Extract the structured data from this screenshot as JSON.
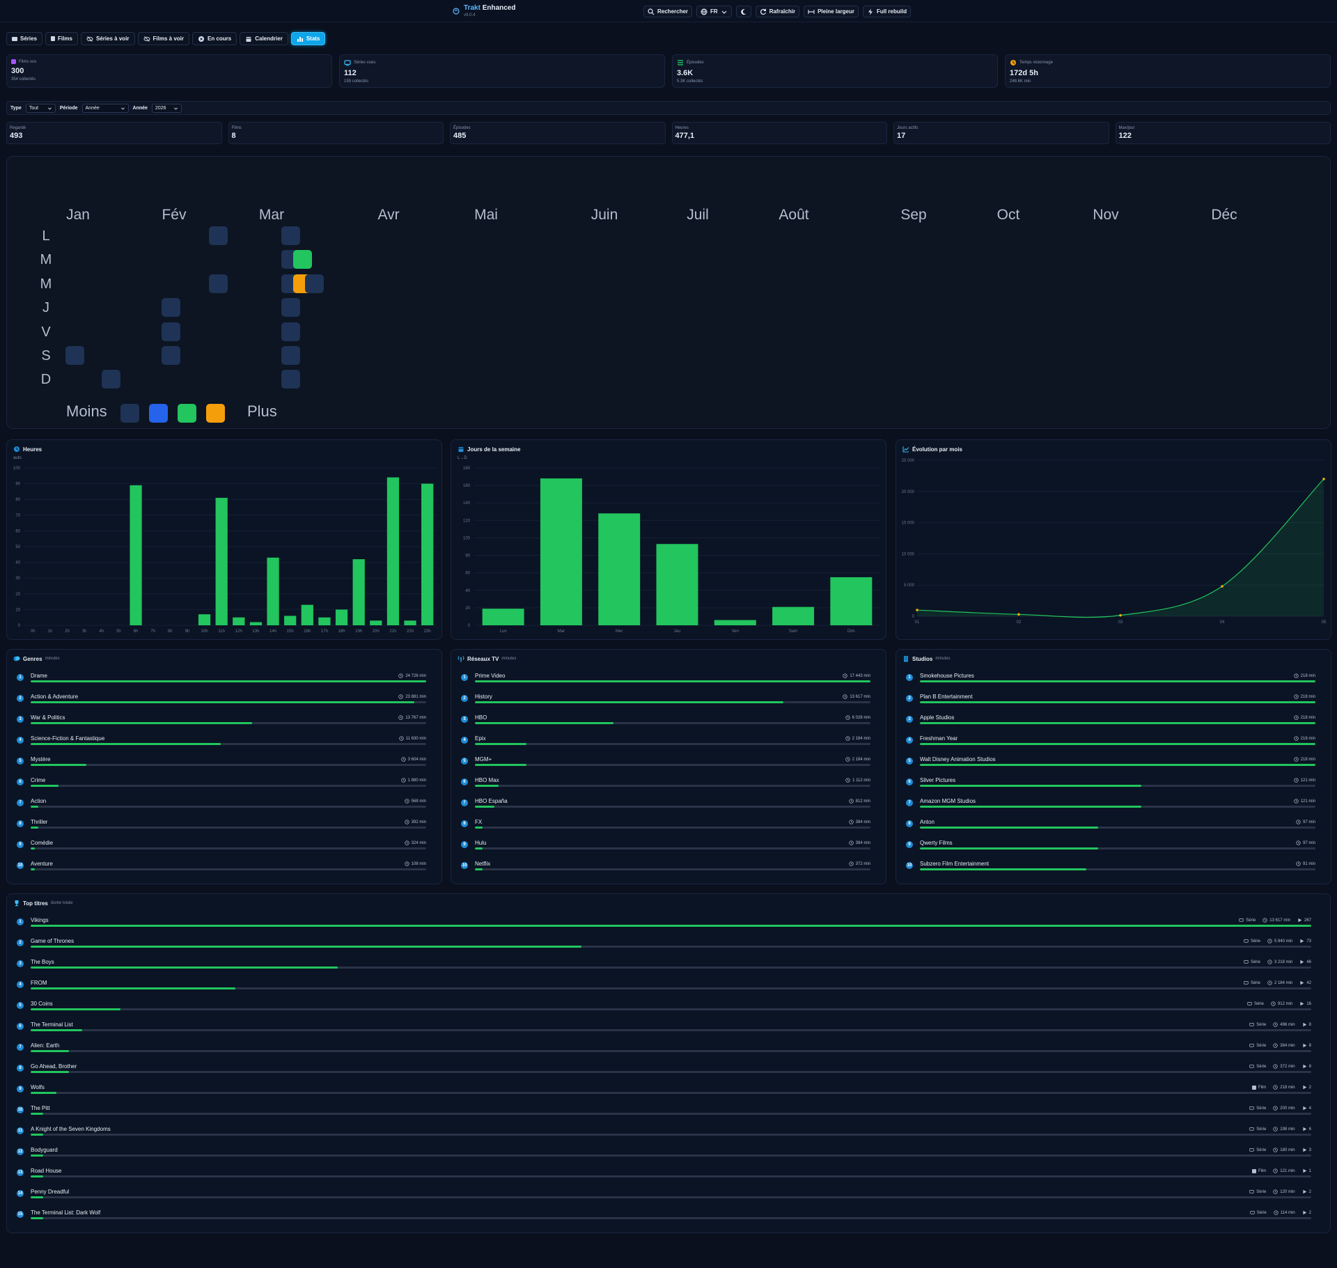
{
  "header": {
    "brand_part1": "Trakt",
    "brand_part2": "Enhanced",
    "version": "v9.0.4",
    "buttons": [
      {
        "label": "Rechercher",
        "icon": "search-icon"
      },
      {
        "label": "FR",
        "icon": "globe-icon"
      },
      {
        "label": "",
        "icon": "moon-icon"
      },
      {
        "label": "Rafraîchir",
        "icon": "refresh-icon"
      },
      {
        "label": "Pleine largeur",
        "icon": "arrows-horizontal-icon"
      },
      {
        "label": "Full rebuild",
        "icon": "bolt-icon"
      }
    ]
  },
  "tabs": [
    {
      "label": "Séries",
      "icon": "tv-icon",
      "active": false
    },
    {
      "label": "Films",
      "icon": "film-icon",
      "active": false
    },
    {
      "label": "Séries à voir",
      "icon": "eye-off-icon",
      "active": false
    },
    {
      "label": "Films à voir",
      "icon": "eye-off-icon",
      "active": false
    },
    {
      "label": "En cours",
      "icon": "play-circle-icon",
      "active": false
    },
    {
      "label": "Calendrier",
      "icon": "calendar-icon",
      "active": false
    },
    {
      "label": "Stats",
      "icon": "bar-chart-icon",
      "active": true
    }
  ],
  "kpis": [
    {
      "label": "Films vus",
      "value": "300",
      "sub": "354 collectés",
      "color": "#a855f7",
      "icon": "film-icon"
    },
    {
      "label": "Séries vues",
      "value": "112",
      "sub": "159 collectés",
      "color": "#38bdf8",
      "icon": "tv-icon"
    },
    {
      "label": "Épisodes",
      "value": "3.6K",
      "sub": "5.3K collectés",
      "color": "#22c55e",
      "icon": "list-icon"
    },
    {
      "label": "Temps visionnage",
      "value": "172d 5h",
      "sub": "248.6K min",
      "color": "#f59e0b",
      "icon": "clock-icon"
    }
  ],
  "filters": {
    "type_label": "Type",
    "type_value": "Tout",
    "period_label": "Période",
    "period_value": "Année",
    "year_label": "Année",
    "year_value": "2026"
  },
  "summary": [
    {
      "label": "Regardé",
      "value": "493"
    },
    {
      "label": "Films",
      "value": "8"
    },
    {
      "label": "Épisodes",
      "value": "485"
    },
    {
      "label": "Heures",
      "value": "477,1"
    },
    {
      "label": "Jours actifs",
      "value": "17"
    },
    {
      "label": "Max/jour",
      "value": "122"
    }
  ],
  "heatmap": {
    "months": [
      "Jan",
      "Fév",
      "Mar",
      "Avr",
      "Mai",
      "Juin",
      "Juil",
      "Août",
      "Sep",
      "Oct",
      "Nov",
      "Déc"
    ],
    "days": [
      "L",
      "M",
      "M",
      "J",
      "V",
      "S",
      "D"
    ],
    "legend_less": "Moins",
    "legend_more": "Plus",
    "level_colors": [
      "#1e3355",
      "#2563eb",
      "#22c55e",
      "#f59e0b"
    ],
    "active_cells": [
      {
        "week": 0,
        "day": 5,
        "level": 0
      },
      {
        "week": 3,
        "day": 6,
        "level": 0
      },
      {
        "week": 8,
        "day": 3,
        "level": 0
      },
      {
        "week": 8,
        "day": 4,
        "level": 0
      },
      {
        "week": 8,
        "day": 5,
        "level": 0
      },
      {
        "week": 12,
        "day": 0,
        "level": 0
      },
      {
        "week": 12,
        "day": 2,
        "level": 0
      },
      {
        "week": 18,
        "day": 0,
        "level": 0
      },
      {
        "week": 18,
        "day": 1,
        "level": 0
      },
      {
        "week": 18,
        "day": 2,
        "level": 0
      },
      {
        "week": 18,
        "day": 3,
        "level": 0
      },
      {
        "week": 18,
        "day": 4,
        "level": 0
      },
      {
        "week": 18,
        "day": 5,
        "level": 0
      },
      {
        "week": 18,
        "day": 6,
        "level": 0
      },
      {
        "week": 19,
        "day": 1,
        "level": 2
      },
      {
        "week": 19,
        "day": 2,
        "level": 3
      },
      {
        "week": 20,
        "day": 2,
        "level": 0
      }
    ]
  },
  "hours_panel": {
    "title": "Heures",
    "hint": "auto"
  },
  "weekday_panel": {
    "title": "Jours de la semaine",
    "hint": "L→D"
  },
  "monthly_panel": {
    "title": "Évolution par mois"
  },
  "chart_data": [
    {
      "type": "bar",
      "title": "Heures",
      "categories": [
        "0h",
        "1h",
        "2h",
        "3h",
        "4h",
        "5h",
        "6h",
        "7h",
        "8h",
        "9h",
        "10h",
        "11h",
        "12h",
        "13h",
        "14h",
        "15h",
        "16h",
        "17h",
        "18h",
        "19h",
        "20h",
        "21h",
        "22h",
        "23h"
      ],
      "values": [
        0,
        0,
        0,
        0,
        0,
        0,
        89,
        0,
        0,
        0,
        7,
        81,
        5,
        2,
        43,
        6,
        13,
        5,
        10,
        42,
        3,
        94,
        3,
        90
      ],
      "ylim": [
        0,
        100
      ],
      "yticks": [
        0,
        10,
        20,
        30,
        40,
        50,
        60,
        70,
        80,
        90,
        100
      ],
      "color": "#22c55e"
    },
    {
      "type": "bar",
      "title": "Jours de la semaine",
      "categories": [
        "Lun",
        "Mar",
        "Mer",
        "Jeu",
        "Ven",
        "Sam",
        "Dim"
      ],
      "values": [
        19,
        168,
        128,
        93,
        6,
        21,
        55
      ],
      "ylim": [
        0,
        180
      ],
      "yticks": [
        0,
        20,
        40,
        60,
        80,
        100,
        120,
        140,
        160,
        180
      ],
      "color": "#22c55e"
    },
    {
      "type": "area",
      "title": "Évolution par mois",
      "categories": [
        "01",
        "02",
        "03",
        "04",
        "05"
      ],
      "values": [
        1000,
        300,
        150,
        4800,
        22000
      ],
      "ylim": [
        0,
        25000
      ],
      "yticks": [
        0,
        5000,
        10000,
        15000,
        20000,
        25000
      ],
      "ytick_labels": [
        "0",
        "5 000",
        "10 000",
        "15 000",
        "20 000",
        "25 000"
      ],
      "color": "#22c55e",
      "point_color": "#eab308"
    }
  ],
  "genres": {
    "title": "Genres",
    "subtitle": "minutes",
    "items": [
      {
        "name": "Drame",
        "value": "24 726 min",
        "pct": 100
      },
      {
        "name": "Action & Adventure",
        "value": "23 881 min",
        "pct": 97
      },
      {
        "name": "War & Politics",
        "value": "13 767 min",
        "pct": 56
      },
      {
        "name": "Science-Fiction & Fantastique",
        "value": "11 630 min",
        "pct": 48
      },
      {
        "name": "Mystère",
        "value": "3 604 min",
        "pct": 14
      },
      {
        "name": "Crime",
        "value": "1 880 min",
        "pct": 7
      },
      {
        "name": "Action",
        "value": "568 min",
        "pct": 2
      },
      {
        "name": "Thriller",
        "value": "392 min",
        "pct": 2
      },
      {
        "name": "Comédie",
        "value": "324 min",
        "pct": 1
      },
      {
        "name": "Aventure",
        "value": "108 min",
        "pct": 1
      }
    ]
  },
  "networks": {
    "title": "Réseaux TV",
    "subtitle": "minutes",
    "items": [
      {
        "name": "Prime Video",
        "value": "17 443 min",
        "pct": 100
      },
      {
        "name": "History",
        "value": "13 617 min",
        "pct": 78
      },
      {
        "name": "HBO",
        "value": "6 028 min",
        "pct": 35
      },
      {
        "name": "Epix",
        "value": "2 184 min",
        "pct": 13
      },
      {
        "name": "MGM+",
        "value": "2 184 min",
        "pct": 13
      },
      {
        "name": "HBO Max",
        "value": "1 112 min",
        "pct": 6
      },
      {
        "name": "HBO España",
        "value": "812 min",
        "pct": 5
      },
      {
        "name": "FX",
        "value": "384 min",
        "pct": 2
      },
      {
        "name": "Hulu",
        "value": "384 min",
        "pct": 2
      },
      {
        "name": "Netflix",
        "value": "372 min",
        "pct": 2
      }
    ]
  },
  "studios": {
    "title": "Studios",
    "subtitle": "minutes",
    "items": [
      {
        "name": "Smokehouse Pictures",
        "value": "218 min",
        "pct": 100
      },
      {
        "name": "Plan B Entertainment",
        "value": "218 min",
        "pct": 100
      },
      {
        "name": "Apple Studios",
        "value": "218 min",
        "pct": 100
      },
      {
        "name": "Freshman Year",
        "value": "218 min",
        "pct": 100
      },
      {
        "name": "Walt Disney Animation Studios",
        "value": "218 min",
        "pct": 100
      },
      {
        "name": "Silver Pictures",
        "value": "121 min",
        "pct": 56
      },
      {
        "name": "Amazon MGM Studios",
        "value": "121 min",
        "pct": 56
      },
      {
        "name": "Anton",
        "value": "97 min",
        "pct": 45
      },
      {
        "name": "Qwerty Films",
        "value": "97 min",
        "pct": 45
      },
      {
        "name": "Subzero Film Entertainment",
        "value": "91 min",
        "pct": 42
      }
    ]
  },
  "top_titles": {
    "title": "Top titres",
    "subtitle": "durée totale",
    "items": [
      {
        "name": "Vikings",
        "kind": "Série",
        "minutes": "13 617 min",
        "plays": "267",
        "pct": 100
      },
      {
        "name": "Game of Thrones",
        "kind": "Série",
        "minutes": "5 840 min",
        "plays": "73",
        "pct": 43
      },
      {
        "name": "The Boys",
        "kind": "Série",
        "minutes": "3 218 min",
        "plays": "46",
        "pct": 24
      },
      {
        "name": "FROM",
        "kind": "Série",
        "minutes": "2 184 min",
        "plays": "42",
        "pct": 16
      },
      {
        "name": "30 Coins",
        "kind": "Série",
        "minutes": "912 min",
        "plays": "16",
        "pct": 7
      },
      {
        "name": "The Terminal List",
        "kind": "Série",
        "minutes": "496 min",
        "plays": "8",
        "pct": 4
      },
      {
        "name": "Alien: Earth",
        "kind": "Série",
        "minutes": "384 min",
        "plays": "8",
        "pct": 3
      },
      {
        "name": "Go Ahead, Brother",
        "kind": "Série",
        "minutes": "372 min",
        "plays": "8",
        "pct": 3
      },
      {
        "name": "Wolfs",
        "kind": "Film",
        "minutes": "218 min",
        "plays": "2",
        "pct": 2
      },
      {
        "name": "The Pitt",
        "kind": "Série",
        "minutes": "200 min",
        "plays": "4",
        "pct": 1
      },
      {
        "name": "A Knight of the Seven Kingdoms",
        "kind": "Série",
        "minutes": "198 min",
        "plays": "6",
        "pct": 1
      },
      {
        "name": "Bodyguard",
        "kind": "Série",
        "minutes": "180 min",
        "plays": "3",
        "pct": 1
      },
      {
        "name": "Road House",
        "kind": "Film",
        "minutes": "121 min",
        "plays": "1",
        "pct": 1
      },
      {
        "name": "Penny Dreadful",
        "kind": "Série",
        "minutes": "120 min",
        "plays": "2",
        "pct": 1
      },
      {
        "name": "The Terminal List: Dark Wolf",
        "kind": "Série",
        "minutes": "114 min",
        "plays": "2",
        "pct": 1
      }
    ]
  }
}
